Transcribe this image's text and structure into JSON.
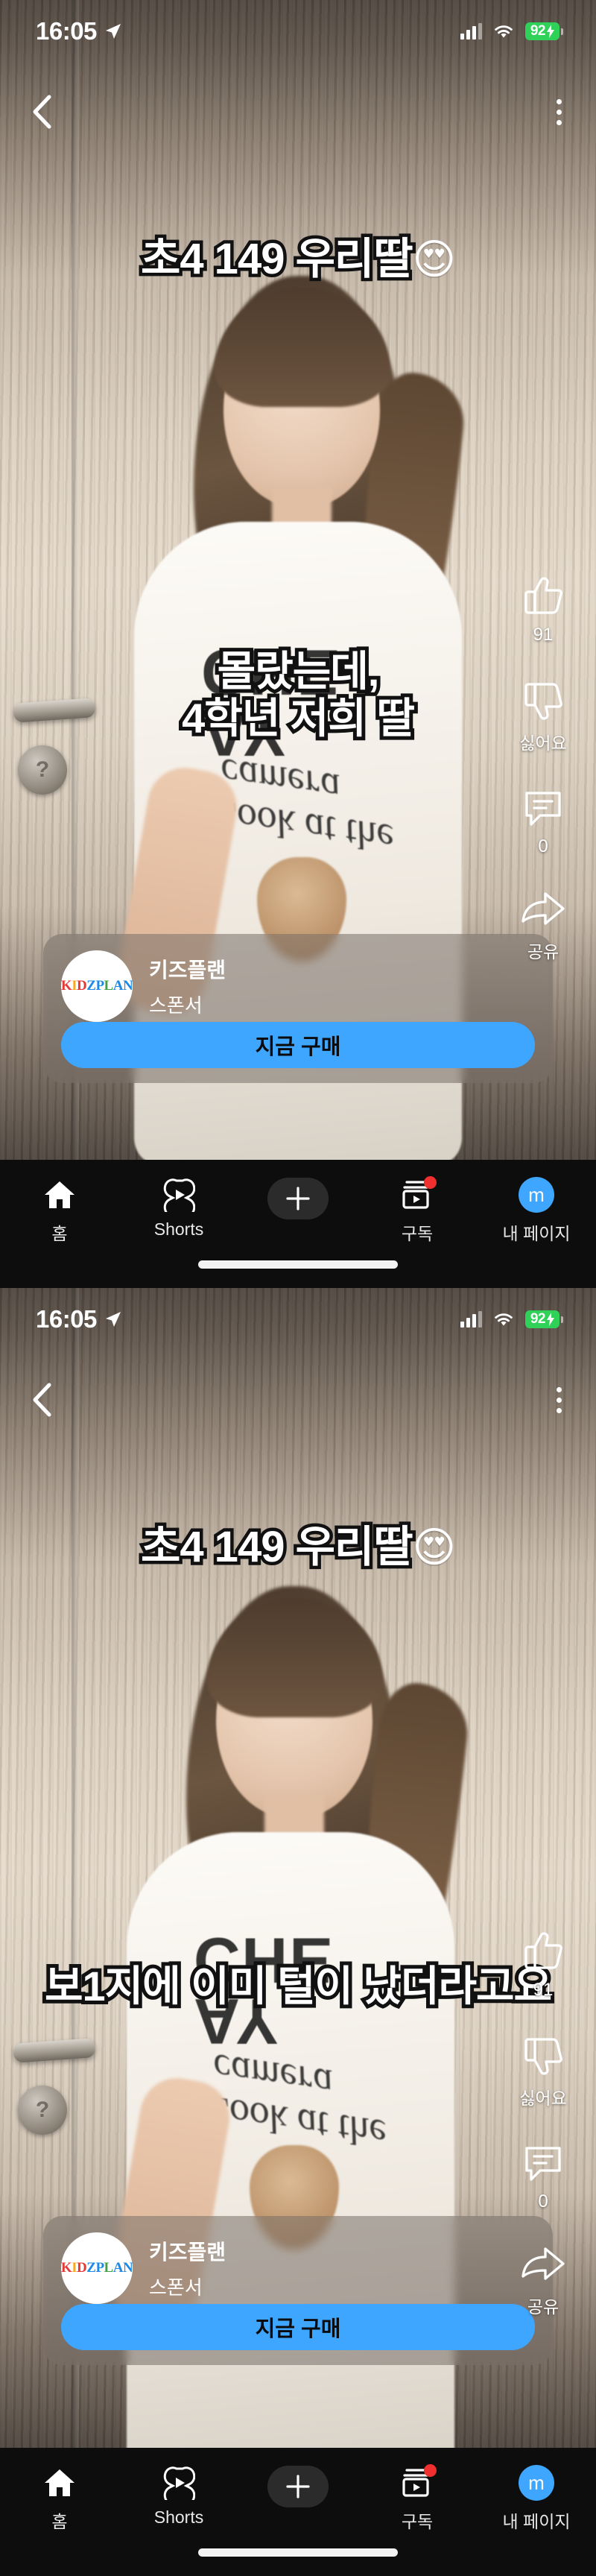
{
  "status_bar": {
    "time": "16:05",
    "location_icon": "location-arrow-icon",
    "signal_icon": "cellular-signal-icon",
    "wifi_icon": "wifi-icon",
    "battery_percent": "92",
    "battery_charging_icon": "lightning-bolt-icon"
  },
  "top_nav": {
    "back_icon": "back-chevron-icon",
    "menu_icon": "kebab-menu-icon"
  },
  "overlay": {
    "title": "초4 149 우리딸",
    "title_emoji": "😍",
    "panel1_caption_line1": "몰랐는데,",
    "panel1_caption_line2": "4학년 저희 딸",
    "panel2_caption": "보1지에 이미 털이 났더라고요"
  },
  "actions": {
    "like": {
      "icon": "thumbs-up-icon",
      "label": "91"
    },
    "dislike": {
      "icon": "thumbs-down-icon",
      "label": "싫어요"
    },
    "comment": {
      "icon": "comment-bubble-icon",
      "label": "0"
    },
    "share": {
      "icon": "share-arrow-icon",
      "label": "공유"
    }
  },
  "ad": {
    "logo_text": "KIDZPLAN",
    "logo_parts": [
      "K",
      "IDZ",
      "P",
      "LAN"
    ],
    "advertiser": "키즈플랜",
    "sponsor_label": "스폰서",
    "cta_label": "지금 구매",
    "cta_color": "#3ea6ff"
  },
  "bottom_nav": {
    "items": [
      {
        "icon": "home-icon",
        "label": "홈"
      },
      {
        "icon": "shorts-icon",
        "label": "Shorts"
      },
      {
        "icon": "plus-icon",
        "label": ""
      },
      {
        "icon": "subscriptions-icon",
        "label": "구독",
        "badge": "red-dot"
      },
      {
        "icon": "profile-avatar-icon",
        "label": "내 페이지",
        "avatar_letter": "m"
      }
    ]
  },
  "video_art": {
    "shirt_text_line": "AY CHE",
    "shirt_script_line": "Look at\nthe camera"
  },
  "colors": {
    "battery_green": "#30d158",
    "accent_blue": "#3ea6ff",
    "nav_background": "#0d0d0d",
    "badge_red": "#f02f2f"
  }
}
